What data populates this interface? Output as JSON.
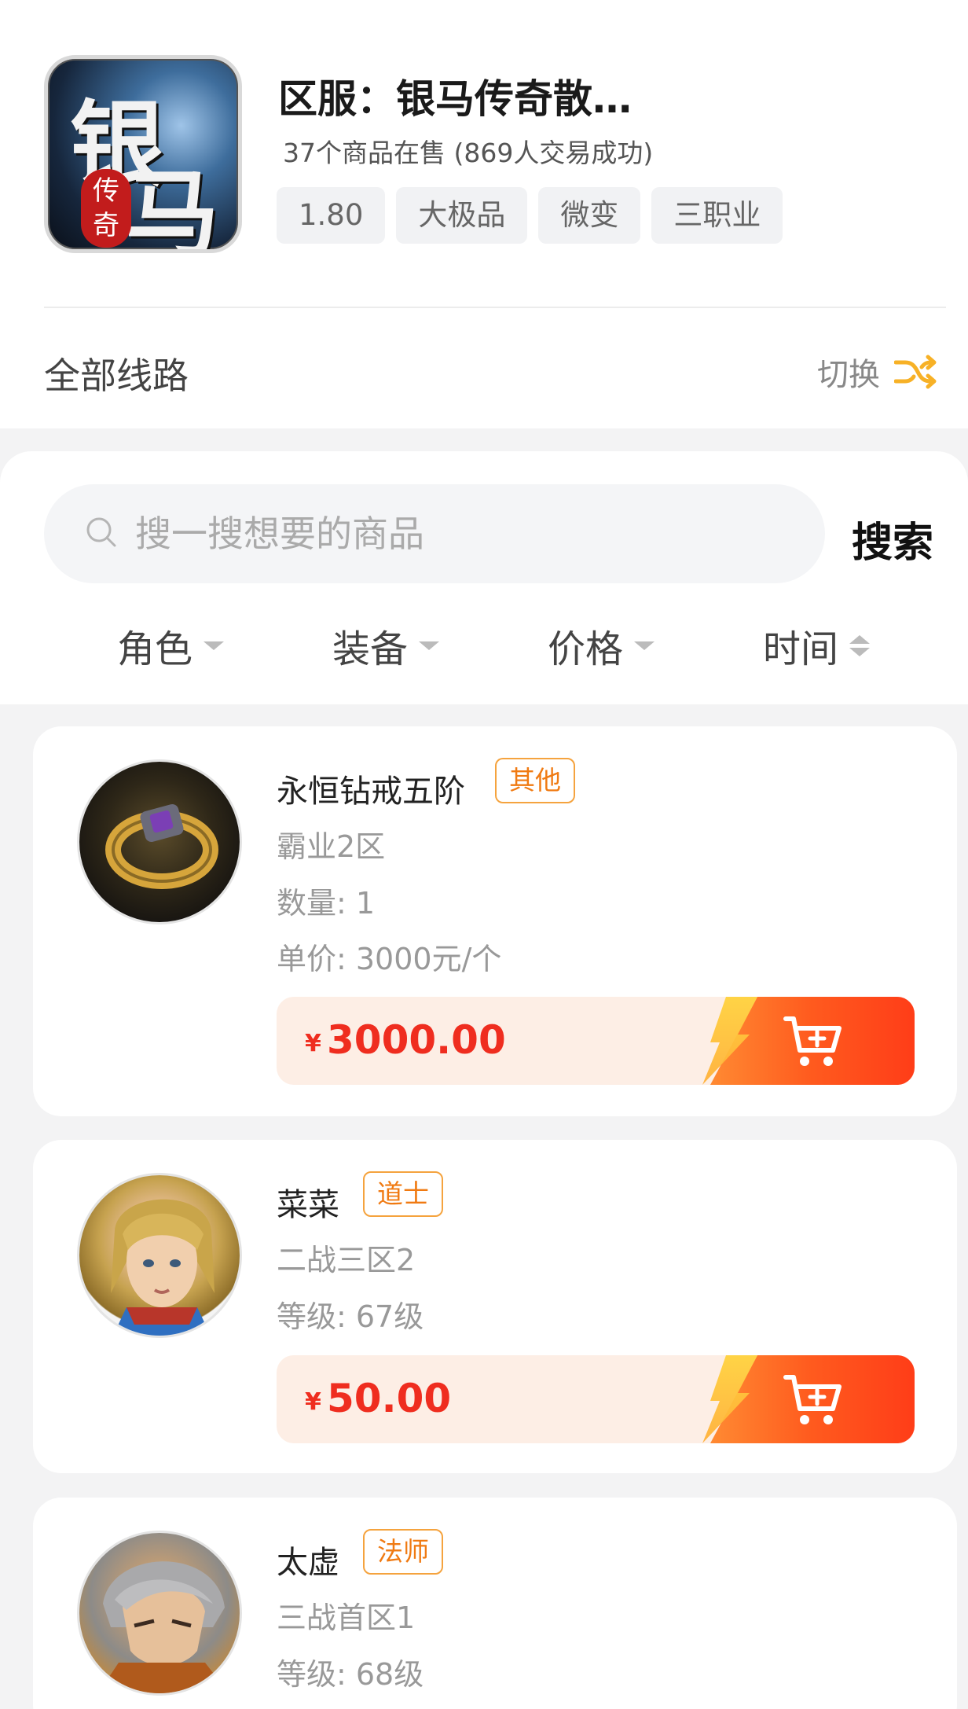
{
  "header": {
    "game_icon_main": "银马",
    "game_icon_seal": "传奇",
    "server_title": "区服：银马传奇散…",
    "server_sub": "37个商品在售 (869人交易成功)",
    "tags": [
      "1.80",
      "大极品",
      "微变",
      "三职业"
    ],
    "line_label": "全部线路",
    "switch_label": "切换"
  },
  "search": {
    "placeholder": "搜一搜想要的商品",
    "button_label": "搜索"
  },
  "filters": [
    {
      "label": "角色"
    },
    {
      "label": "装备"
    },
    {
      "label": "价格"
    },
    {
      "label": "时间"
    }
  ],
  "items": [
    {
      "name": "永恒钻戒五阶",
      "badge": "其他",
      "lines": [
        "霸业2区",
        "数量: 1",
        "单价: 3000元/个"
      ],
      "currency": "¥",
      "price": "3000.00"
    },
    {
      "name": "菜菜",
      "badge": "道士",
      "lines": [
        "二战三区2",
        "等级: 67级"
      ],
      "currency": "¥",
      "price": "50.00"
    },
    {
      "name": "太虚",
      "badge": "法师",
      "lines": [
        "三战首区1",
        "等级: 68级"
      ]
    }
  ],
  "colors": {
    "accent": "#ff5a1e",
    "price": "#ef2d1f",
    "badge": "#f07a12"
  }
}
